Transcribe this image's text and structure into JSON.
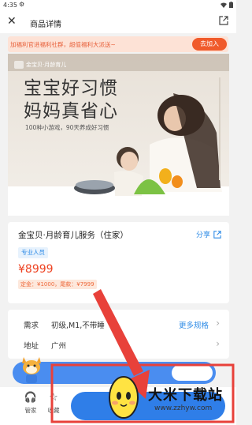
{
  "status_bar": {
    "time": "4:35"
  },
  "header": {
    "title": "商品详情"
  },
  "promo": {
    "text": "加福利官进福利社群，超值福利大派送~",
    "button": "去加入"
  },
  "hero": {
    "brand": "金宝贝·月龄育儿",
    "headline_line1": "宝宝好习惯",
    "headline_line2": "妈妈真省心",
    "subline": "100种小游戏，90天养成好习惯"
  },
  "product": {
    "name": "金宝贝·月龄育儿服务（住家）",
    "share_label": "分享",
    "tag": "专业人员",
    "price": "¥8999",
    "deposit": "定金：¥1000，尾款：¥7999"
  },
  "specs": {
    "demand_label": "需求",
    "demand_value": "初级,M1,不带睡",
    "more_label": "更多规格",
    "address_label": "地址",
    "address_value": "广州"
  },
  "bottom_bar": {
    "steward_label": "管家",
    "favorite_label": "收藏"
  },
  "watermark": {
    "brand": "大米下载站",
    "url": "www.zzhyw.com"
  },
  "colors": {
    "accent": "#2e8be6",
    "price": "#ee4322",
    "promo": "#f05a2b",
    "annotation": "#e8413a"
  }
}
